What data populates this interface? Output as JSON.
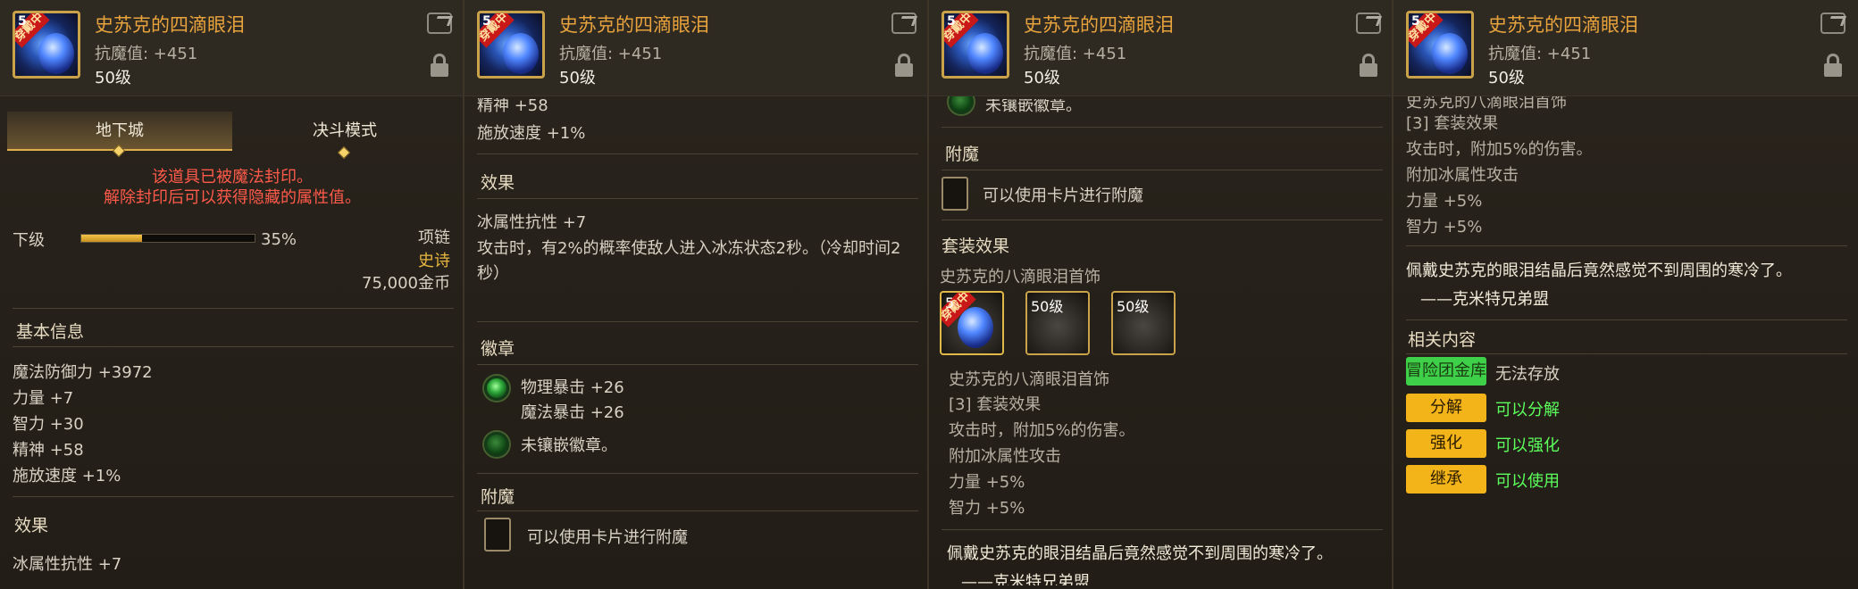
{
  "item": {
    "name": "史苏克的四滴眼泪",
    "resist": "抗魔值: +451",
    "level": "50级",
    "equipped_tag": "穿戴中",
    "level_mark": "5"
  },
  "panel1": {
    "tabs": [
      "地下城",
      "决斗模式"
    ],
    "seal_line1": "该道具已被魔法封印。",
    "seal_line2": "解除封印后可以获得隐藏的属性值。",
    "grade_label": "下级",
    "grade_percent_text": "35%",
    "grade_fill": 0.35,
    "slot": "项链",
    "rarity": "史诗",
    "price": "75,000金币",
    "basic_title": "基本信息",
    "stats": [
      "魔法防御力 +3972",
      "力量 +7",
      "智力 +30",
      "精神 +58",
      "施放速度 +1%"
    ],
    "effect_title": "效果",
    "effect_first": "冰属性抗性 +7"
  },
  "panel2": {
    "top_cut": "精神 +58",
    "cast_speed": "施放速度 +1%",
    "effect_title": "效果",
    "effect_lines": [
      "冰属性抗性 +7",
      "攻击时，有2%的概率使敌人进入冰冻状态2秒。（冷却时间2",
      "秒）"
    ],
    "emblem_title": "徽章",
    "emblem_lines": [
      "物理暴击 +26",
      "魔法暴击 +26"
    ],
    "emblem_empty": "未镶嵌徽章。",
    "enchant_title": "附魔",
    "enchant_text": "可以使用卡片进行附魔"
  },
  "panel3": {
    "emblem_empty_cut": "未镶嵌徽章。",
    "enchant_title": "附魔",
    "enchant_text": "可以使用卡片进行附魔",
    "set_title": "套装效果",
    "set_name": "史苏克的八滴眼泪首饰",
    "set_items": [
      {
        "label": "5",
        "tag": "穿戴中"
      },
      {
        "label": "50级"
      },
      {
        "label": "50级"
      }
    ],
    "set_name2": "史苏克的八滴眼泪首饰",
    "set_bonus_title": "[3] 套装效果",
    "set_lines": [
      "攻击时，附加5%的伤害。",
      "附加冰属性攻击",
      "力量 +5%",
      "智力 +5%"
    ],
    "flavor": "佩戴史苏克的眼泪结晶后竟然感觉不到周围的寒冷了。",
    "flavor_cut": "——克米特兄弟盟"
  },
  "panel4": {
    "top_cut": "史苏克的八滴眼泪首饰",
    "set_bonus_title": "[3] 套装效果",
    "set_lines": [
      "攻击时，附加5%的伤害。",
      "附加冰属性攻击",
      "力量 +5%",
      "智力 +5%"
    ],
    "flavor": "佩戴史苏克的眼泪结晶后竟然感觉不到周围的寒冷了。",
    "author": "——克米特兄弟盟",
    "related_title": "相关内容",
    "actions": [
      {
        "button": "冒险团金库",
        "status": "无法存放",
        "color": "green"
      },
      {
        "button": "分解",
        "status": "可以分解",
        "color": "yellow"
      },
      {
        "button": "强化",
        "status": "可以强化",
        "color": "yellow"
      },
      {
        "button": "继承",
        "status": "可以使用",
        "color": "yellow"
      }
    ]
  }
}
